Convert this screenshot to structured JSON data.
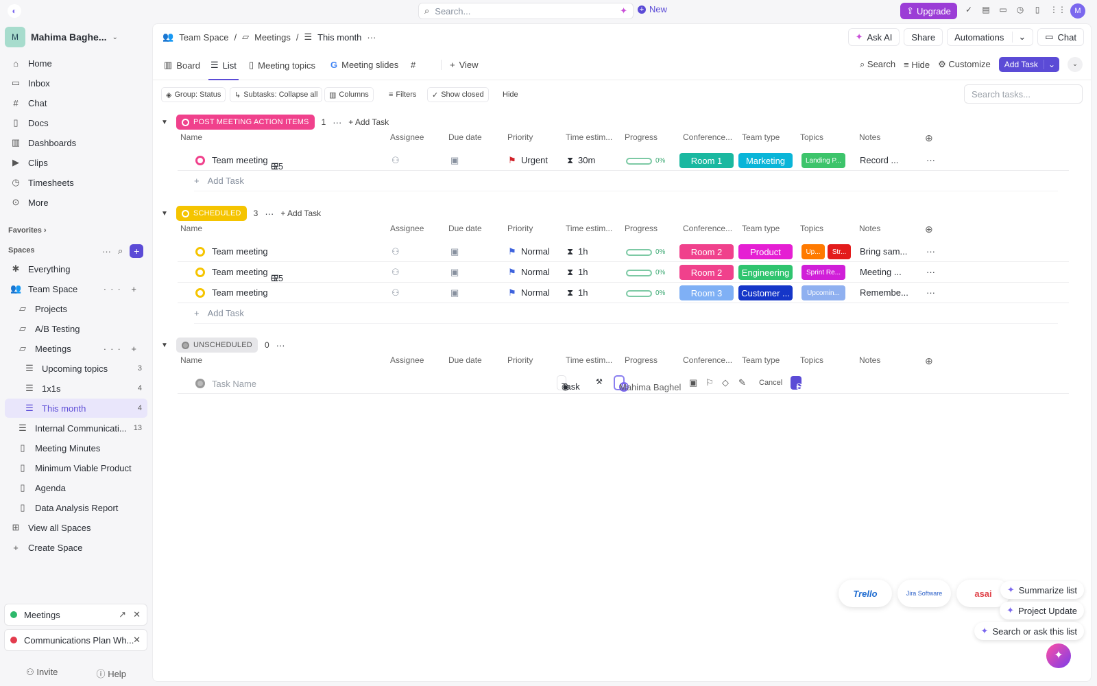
{
  "topbar": {
    "search_placeholder": "Search...",
    "new_label": "New",
    "upgrade_label": "Upgrade",
    "avatar_initial": "M"
  },
  "sidebar": {
    "workspace_initial": "M",
    "workspace_name": "Mahima Baghe...",
    "nav": [
      {
        "label": "Home",
        "icon": "home-icon"
      },
      {
        "label": "Inbox",
        "icon": "inbox-icon"
      },
      {
        "label": "Chat",
        "icon": "chat-icon"
      },
      {
        "label": "Docs",
        "icon": "docs-icon"
      },
      {
        "label": "Dashboards",
        "icon": "dashboards-icon"
      },
      {
        "label": "Clips",
        "icon": "clips-icon"
      },
      {
        "label": "Timesheets",
        "icon": "timesheets-icon"
      },
      {
        "label": "More",
        "icon": "more-icon"
      }
    ],
    "favorites_label": "Favorites",
    "spaces_label": "Spaces",
    "tree": [
      {
        "label": "Everything",
        "count": ""
      },
      {
        "label": "Team Space",
        "count": ""
      },
      {
        "label": "Projects",
        "count": ""
      },
      {
        "label": "A/B Testing",
        "count": ""
      },
      {
        "label": "Meetings",
        "count": ""
      },
      {
        "label": "Upcoming topics",
        "count": "3"
      },
      {
        "label": "1x1s",
        "count": "4"
      },
      {
        "label": "This month",
        "count": "4"
      },
      {
        "label": "Internal Communicati...",
        "count": "13"
      },
      {
        "label": "Meeting Minutes",
        "count": ""
      },
      {
        "label": "Minimum Viable Product",
        "count": ""
      },
      {
        "label": "Agenda",
        "count": ""
      },
      {
        "label": "Data Analysis Report",
        "count": ""
      },
      {
        "label": "View all Spaces",
        "count": ""
      },
      {
        "label": "Create Space",
        "count": ""
      }
    ],
    "tray": [
      {
        "label": "Meetings"
      },
      {
        "label": "Communications Plan Wh..."
      }
    ],
    "invite_label": "Invite",
    "help_label": "Help"
  },
  "header": {
    "crumbs": [
      "Team Space",
      "Meetings",
      "This month"
    ],
    "ask_ai": "Ask AI",
    "share": "Share",
    "automations": "Automations",
    "chat": "Chat"
  },
  "views": {
    "tabs": [
      "Board",
      "List",
      "Meeting topics",
      "Meeting slides",
      "#",
      "View"
    ],
    "search": "Search",
    "hide": "Hide",
    "customize": "Customize",
    "add_task": "Add Task"
  },
  "filters": {
    "group": "Group: Status",
    "subtasks": "Subtasks: Collapse all",
    "columns": "Columns",
    "filters": "Filters",
    "show_closed": "Show closed",
    "hide": "Hide",
    "search_placeholder": "Search tasks..."
  },
  "columns": [
    "Name",
    "Assignee",
    "Due date",
    "Priority",
    "Time estim...",
    "Progress",
    "Conference...",
    "Team type",
    "Topics",
    "Notes"
  ],
  "groups": [
    {
      "label": "POST MEETING ACTION ITEMS",
      "color": "#f0418c",
      "count": "1",
      "add_task": "Add Task",
      "tasks": [
        {
          "name": "Team meeting",
          "subtasks": "0/5",
          "priority": "Urgent",
          "priority_color": "#d1232a",
          "time": "30m",
          "progress": "0%",
          "room": "Room 1",
          "room_color": "#1ab8a0",
          "team": "Marketing",
          "team_color": "#0ab5d8",
          "topics": [
            {
              "label": "Landing P...",
              "color": "#3dc46b"
            }
          ],
          "notes": "Record ..."
        }
      ]
    },
    {
      "label": "SCHEDULED",
      "color": "#f5c400",
      "count": "3",
      "add_task": "Add Task",
      "tasks": [
        {
          "name": "Team meeting",
          "subtasks": "",
          "priority": "Normal",
          "priority_color": "#3e63dd",
          "time": "1h",
          "progress": "0%",
          "room": "Room 2",
          "room_color": "#f0418c",
          "team": "Product",
          "team_color": "#e51fd3",
          "topics": [
            {
              "label": "Up...",
              "color": "#ff7a00"
            },
            {
              "label": "Str...",
              "color": "#e31b1b"
            }
          ],
          "notes": "Bring sam..."
        },
        {
          "name": "Team meeting",
          "subtasks": "0/5",
          "priority": "Normal",
          "priority_color": "#3e63dd",
          "time": "1h",
          "progress": "0%",
          "room": "Room 2",
          "room_color": "#f0418c",
          "team": "Engineering",
          "team_color": "#2fc46f",
          "topics": [
            {
              "label": "Sprint Re...",
              "color": "#d01fd8"
            }
          ],
          "notes": "Meeting ..."
        },
        {
          "name": "Team meeting",
          "subtasks": "",
          "priority": "Normal",
          "priority_color": "#3e63dd",
          "time": "1h",
          "progress": "0%",
          "room": "Room 3",
          "room_color": "#7fb0f5",
          "team": "Customer ...",
          "team_color": "#1536c8",
          "topics": [
            {
              "label": "Upcomin...",
              "color": "#8fb0f0"
            }
          ],
          "notes": "Remembe..."
        }
      ]
    },
    {
      "label": "UNSCHEDULED",
      "color": "#e0e0e3",
      "count": "0",
      "add_task": "",
      "tasks": []
    }
  ],
  "add_task_row": "Add Task",
  "new_task": {
    "placeholder": "Task Name",
    "type": "Task",
    "assignee": "Mahima Baghel",
    "assignee_initials": "MB",
    "cancel": "Cancel",
    "save": "Save"
  },
  "integrations": [
    "Trello",
    "Jira Software",
    "asai"
  ],
  "ai_actions": [
    "Summarize list",
    "Project Update",
    "Search or ask this list"
  ]
}
